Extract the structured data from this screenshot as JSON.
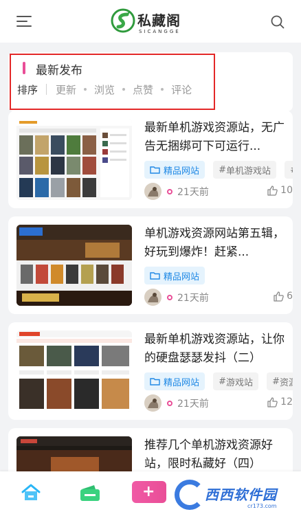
{
  "header": {
    "logo_cn": "私藏阁",
    "logo_en": "SICANGGE"
  },
  "filter": {
    "title": "最新发布",
    "sort_label": "排序",
    "options": [
      "更新",
      "浏览",
      "点赞",
      "评论"
    ]
  },
  "posts": [
    {
      "title": "最新单机游戏资源站，无广告无捆绑可下可运行...",
      "tags": [
        {
          "label": "精品网站",
          "type": "category"
        },
        {
          "label": "单机游戏站",
          "type": "hashtag"
        },
        {
          "label": "",
          "type": "hashtag"
        }
      ],
      "time": "21天前",
      "likes": "10"
    },
    {
      "title": "单机游戏资源网站第五辑，好玩到爆炸！赶紧...",
      "tags": [
        {
          "label": "精品网站",
          "type": "category"
        }
      ],
      "time": "21天前",
      "likes": "6"
    },
    {
      "title": "最新单机游戏资源站，让你的硬盘瑟瑟发抖（二）",
      "tags": [
        {
          "label": "精品网站",
          "type": "category"
        },
        {
          "label": "游戏站",
          "type": "hashtag"
        },
        {
          "label": "资源",
          "type": "hashtag"
        }
      ],
      "time": "21天前",
      "likes": "12"
    },
    {
      "title": "推荐几个单机游戏资源好站，限时私藏好（四）",
      "tags": [],
      "time": "",
      "likes": ""
    }
  ],
  "bottom_nav": {
    "items": [
      "home-icon",
      "wallet-icon",
      "add-icon"
    ]
  },
  "watermark": {
    "text": "西西软件园",
    "url": "cr173.com"
  },
  "colors": {
    "accent_pink": "#e94e97",
    "tag_blue": "#1e88e5",
    "highlight_red": "#e32727"
  }
}
